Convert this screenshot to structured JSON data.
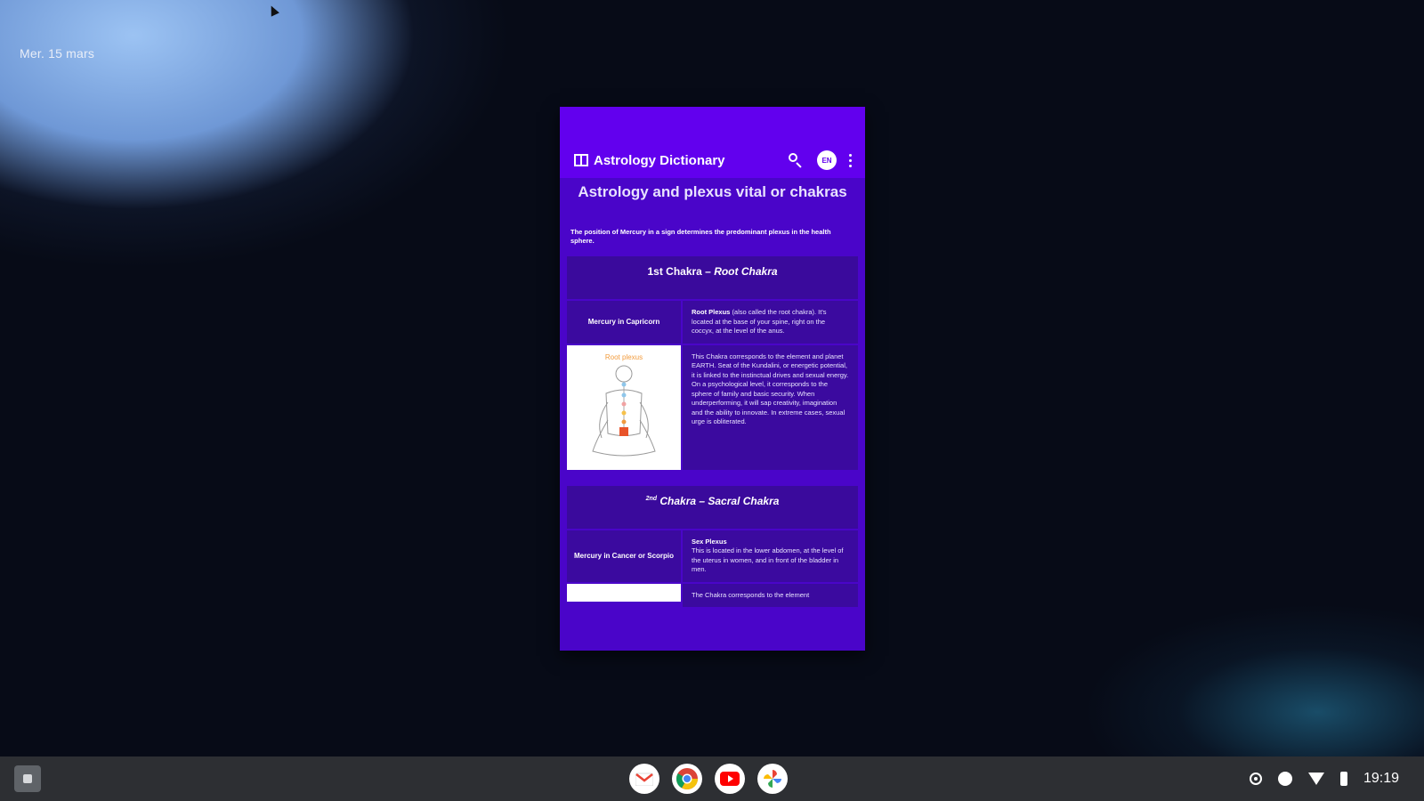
{
  "desktop": {
    "date": "Mer. 15 mars"
  },
  "app": {
    "title": "Astrology Dictionary",
    "lang_badge": "EN",
    "page_heading": "Astrology and plexus vital or chakras",
    "intro": "The position of Mercury in a sign determines the predominant plexus in the health sphere.",
    "chakras": [
      {
        "header_main": "1st Chakra",
        "header_sep": " – ",
        "header_name": "Root Chakra",
        "governs": "Mercury in Capricorn",
        "plexus_title": "Root Plexus",
        "plexus_text": "(also called the root chakra). It's located at the base of your spine, right on the coccyx, at the level of the anus.",
        "image_label": "Root plexus",
        "description": "This Chakra corresponds to the element and planet EARTH. Seat of the Kundalini, or energetic potential, it is linked to the instinctual drives and sexual energy. On a psychological level, it corresponds to the sphere of family and basic security. When underperforming, it will sap creativity, imagination and the ability to innovate. In extreme cases, sexual urge is obliterated."
      },
      {
        "header_sup": "2nd",
        "header_rest": " Chakra – Sacral Chakra",
        "governs": "Mercury in Cancer or Scorpio",
        "plexus_title": "Sex Plexus",
        "plexus_text": "This is located in the lower abdomen, at the level of the uterus in women, and in front of the bladder in men.",
        "description": "The Chakra corresponds to the element"
      }
    ]
  },
  "shelf": {
    "apps": [
      "Gmail",
      "Chrome",
      "YouTube",
      "Photos"
    ],
    "time": "19:19"
  },
  "colors": {
    "toolbar": "#6200ee",
    "window_bg": "#4a05c9",
    "cell_bg": "#3b0a9f"
  }
}
